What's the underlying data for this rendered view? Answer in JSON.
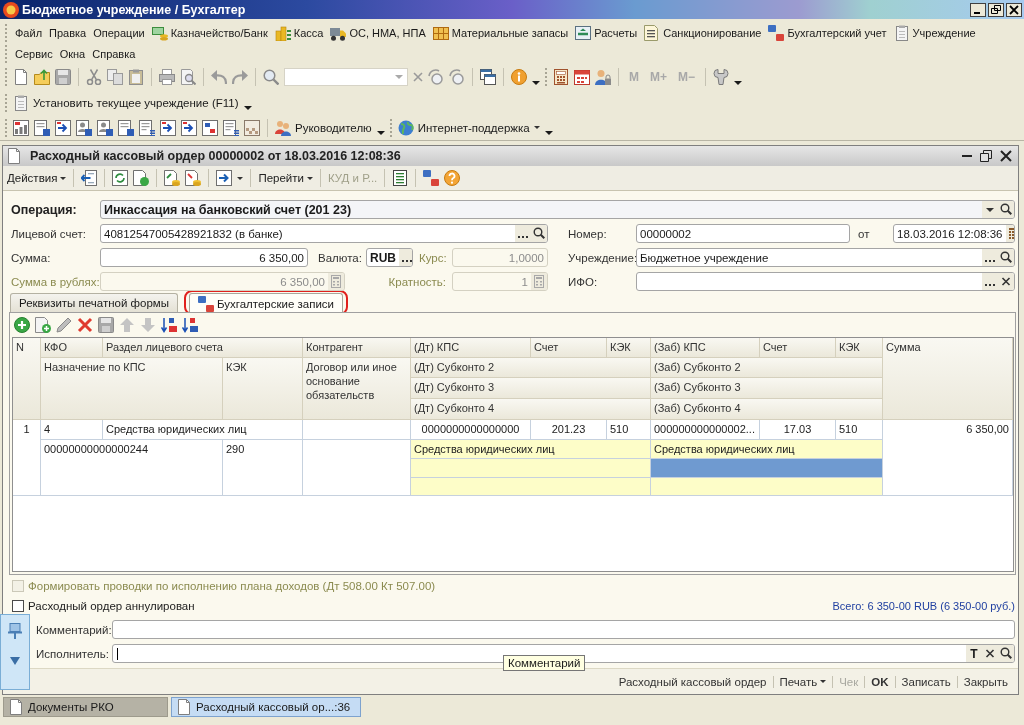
{
  "window": {
    "title": "Бюджетное учреждение / Бухгалтер"
  },
  "menu_rows": [
    [
      {
        "label": "Файл",
        "kind": "plain"
      },
      {
        "label": "Правка",
        "kind": "plain"
      },
      {
        "label": "Операции",
        "kind": "plain"
      },
      {
        "label": "Казначейство/Банк",
        "kind": "iconic"
      },
      {
        "label": "Касса",
        "kind": "iconic"
      },
      {
        "label": "ОС, НМА, НПА",
        "kind": "iconic"
      },
      {
        "label": "Материальные запасы",
        "kind": "iconic"
      },
      {
        "label": "Расчеты",
        "kind": "iconic"
      },
      {
        "label": "Санкционирование",
        "kind": "iconic"
      },
      {
        "label": "Бухгалтерский учет",
        "kind": "iconic"
      },
      {
        "label": "Учреждение",
        "kind": "iconic"
      }
    ],
    [
      {
        "label": "Сервис",
        "kind": "plain"
      },
      {
        "label": "Окна",
        "kind": "plain"
      },
      {
        "label": "Справка",
        "kind": "plain"
      }
    ]
  ],
  "toolbar": {
    "memory_buttons": [
      {
        "label": "M",
        "disabled": true
      },
      {
        "label": "M+",
        "disabled": true
      },
      {
        "label": "M−",
        "disabled": true
      }
    ]
  },
  "institution_bar": {
    "label": "Установить текущее учреждение (F11)"
  },
  "reports_bar": {
    "manager": "Руководителю",
    "support": "Интернет-поддержка"
  },
  "document": {
    "title": "Расходный кассовый ордер 00000002 от 18.03.2016 12:08:36",
    "toolbar": [
      {
        "label": "Действия",
        "menu": true,
        "disabled": false
      },
      {
        "label": "Перейти",
        "menu": true,
        "disabled": false
      },
      {
        "label": "КУД и Р...",
        "menu": false,
        "disabled": true
      }
    ]
  },
  "form": {
    "operation": {
      "label": "Операция:",
      "value": "Инкассация на банковский счет (201 23)"
    },
    "account": {
      "label": "Лицевой счет:",
      "value": "40812547005428921832 (в банке)"
    },
    "number": {
      "label": "Номер:",
      "value": "00000002"
    },
    "date": {
      "label": "от",
      "value": "18.03.2016 12:08:36"
    },
    "amount": {
      "label": "Сумма:",
      "value": "6 350,00"
    },
    "currency": {
      "label": "Валюта:",
      "value": "RUB"
    },
    "rate": {
      "label": "Курс:",
      "value": "1,0000",
      "disabled": true
    },
    "institution": {
      "label": "Учреждение:",
      "value": "Бюджетное учреждение"
    },
    "amount_rub": {
      "label": "Сумма в рублях:",
      "value": "6 350,00",
      "disabled": true
    },
    "multiplicity": {
      "label": "Кратность:",
      "value": "1",
      "disabled": true
    },
    "ifo": {
      "label": "ИФО:"
    }
  },
  "tabs": [
    {
      "label": "Реквизиты печатной формы",
      "kind": "plain",
      "selected": false,
      "annotated": false
    },
    {
      "label": "Бухгалтерские записи",
      "kind": "iconic",
      "selected": true,
      "annotated": true
    }
  ],
  "table": {
    "header": {
      "number": "N",
      "kfo": "КФО",
      "section": "Раздел лицевого счета",
      "counterparty": "Контрагент",
      "dt_kps": "(Дт) КПС",
      "dt_account": "Счет",
      "dt_kek": "КЭК",
      "zab_kps": "(Заб) КПС",
      "zab_account": "Счет",
      "zab_kek": "КЭК",
      "amount": "Сумма",
      "purpose": "Назначение по КПС",
      "kek": "КЭК",
      "contract": "Договор или иное основание обязательств",
      "dt_subconto": [
        "(Дт) Субконто 2",
        "(Дт) Субконто 3",
        "(Дт) Субконто 4"
      ],
      "zab_subconto": [
        "(Заб) Субконто 2",
        "(Заб) Субконто 3",
        "(Заб) Субконто 4"
      ]
    },
    "rows": [
      {
        "number": "1",
        "kfo": "4",
        "section": "Средства юридических лиц",
        "dt_kps": "0000000000000000",
        "dt_account": "201.23",
        "dt_kek": "510",
        "zab_kps": "000000000000002...",
        "zab_account": "17.03",
        "zab_kek": "510",
        "amount": "6 350,00",
        "purpose": "00000000000000244",
        "kek": "290",
        "dt_subconto": [
          {
            "text": "Средства юридических лиц",
            "selected": false
          },
          {
            "selected": false
          },
          {
            "selected": false
          }
        ],
        "zab_subconto": [
          {
            "text": "Средства юридических лиц",
            "selected": false
          },
          {
            "selected": true
          },
          {
            "selected": false
          }
        ]
      }
    ]
  },
  "footer": {
    "income_plan": {
      "label": "Формировать проводки по исполнению плана доходов (Дт 508.00 Кт 507.00)",
      "checked": false,
      "disabled": true
    },
    "cancelled": {
      "label": "Расходный ордер аннулирован",
      "checked": false,
      "disabled": false
    },
    "total": "Всего: 6 350-00 RUB (6 350-00 руб.)",
    "comment": {
      "label": "Комментарий:"
    },
    "executor": {
      "label": "Исполнитель:",
      "focused": true,
      "text_button": "T"
    },
    "buttons": [
      {
        "label": "Расходный кассовый ордер",
        "kind": "plain",
        "disabled": false
      },
      {
        "label": "Печать",
        "kind": "menu",
        "disabled": false
      },
      {
        "label": "Чек",
        "kind": "plain",
        "disabled": true
      },
      {
        "label": "OK",
        "kind": "default",
        "disabled": false
      },
      {
        "label": "Записать",
        "kind": "plain",
        "disabled": false
      },
      {
        "label": "Закрыть",
        "kind": "plain",
        "disabled": false
      }
    ]
  },
  "tooltip": {
    "text": "Комментарий"
  },
  "taskbar": [
    {
      "label": "Документы РКО",
      "selected": false
    },
    {
      "label": "Расходный кассовый ор...:36",
      "selected": true
    }
  ]
}
